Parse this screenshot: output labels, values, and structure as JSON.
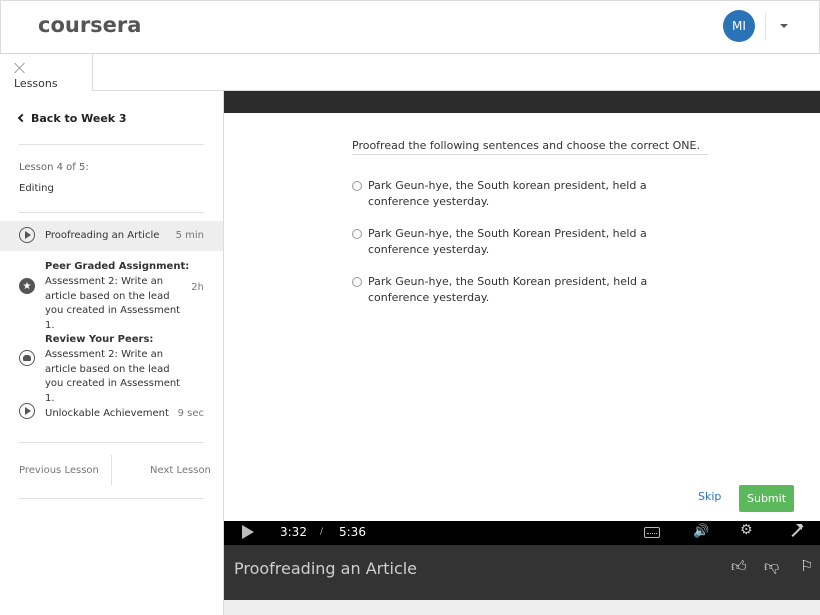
{
  "header": {
    "logo": "coursera",
    "avatar_initials": "MI"
  },
  "tabs": {
    "lessons_label": "Lessons"
  },
  "sidebar": {
    "back_label": "Back to Week 3",
    "lesson_of": "Lesson 4 of 5:",
    "lesson_name": "Editing",
    "items": [
      {
        "title": "Proofreading an Article",
        "time": "5 min",
        "icon": "play-circle-icon",
        "active": true
      },
      {
        "title": "Peer Graded Assignment:",
        "desc": "Assessment 2: Write an article based on the lead you created in Assessment 1.",
        "time": "2h",
        "icon": "star-icon"
      },
      {
        "title": "Review Your Peers:",
        "desc": "Assessment 2: Write an article based on the lead you created in Assessment 1.",
        "time": "",
        "icon": "peers-icon"
      },
      {
        "title": "Unlockable Achievement",
        "time": "9 sec",
        "icon": "play-circle-icon"
      }
    ],
    "previous_label": "Previous Lesson",
    "next_label": "Next Lesson"
  },
  "quiz": {
    "question": "Proofread the following sentences and choose the correct ONE.",
    "options": [
      "Park Geun-hye, the South korean president, held a conference yesterday.",
      "Park Geun-hye, the South Korean President, held a conference yesterday.",
      "Park Geun-hye, the South Korean president, held a conference yesterday."
    ],
    "skip_label": "Skip",
    "submit_label": "Submit"
  },
  "player": {
    "current_time": "3:32",
    "separator": "/",
    "total_time": "5:36",
    "video_title": "Proofreading an Article"
  },
  "colors": {
    "accent_blue": "#2a73b7",
    "submit_green": "#5cb85c"
  }
}
